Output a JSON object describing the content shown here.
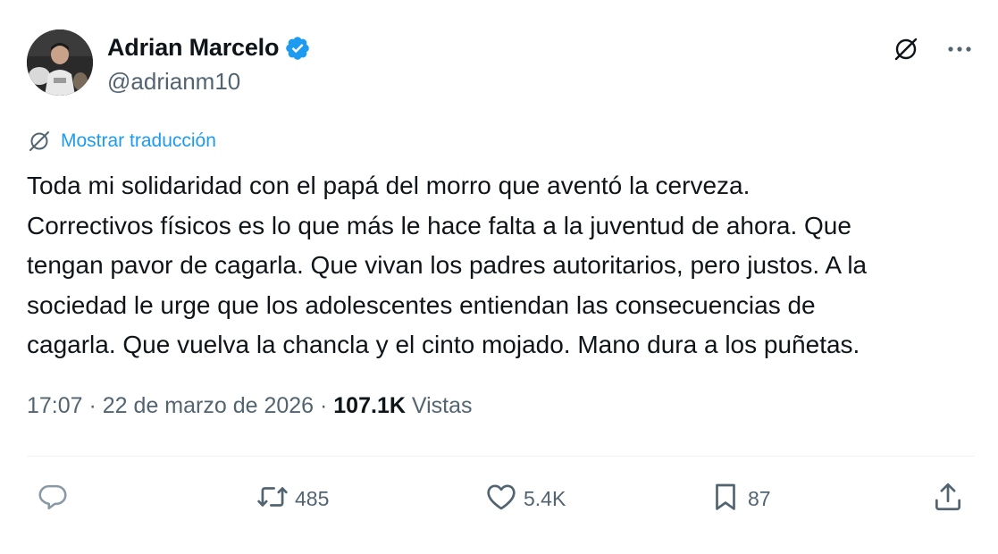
{
  "author": {
    "display_name": "Adrian Marcelo",
    "handle": "@adrianm10",
    "verified": true
  },
  "translate": {
    "label": "Mostrar traducción"
  },
  "tweet": {
    "lines": [
      "Toda mi solidaridad con el papá del morro que aventó la cerveza.",
      "Correctivos físicos es lo que más le hace falta a la juventud de ahora. Que",
      "tengan pavor de cagarla. Que vivan los padres autoritarios, pero justos. A la",
      "sociedad le urge que los adolescentes entiendan las consecuencias de",
      "cagarla. Que vuelva la chancla y el cinto mojado. Mano dura a los puñetas."
    ]
  },
  "meta": {
    "time": "17:07",
    "separator": " · ",
    "date": "22 de marzo de 2026",
    "views_count": "107.1K",
    "views_label": "Vistas"
  },
  "actions": {
    "reply_count": "",
    "retweet_count": "485",
    "like_count": "5.4K",
    "bookmark_count": "87"
  },
  "icons": {
    "verified": "verified-badge-icon",
    "translate": "translate-icon",
    "more": "more-icon",
    "reply": "reply-icon",
    "retweet": "retweet-icon",
    "like": "heart-icon",
    "bookmark": "bookmark-icon",
    "share": "share-icon"
  },
  "colors": {
    "accent": "#1d9bf0",
    "text": "#0f1419",
    "muted": "#536471",
    "divider": "#eff3f4"
  }
}
